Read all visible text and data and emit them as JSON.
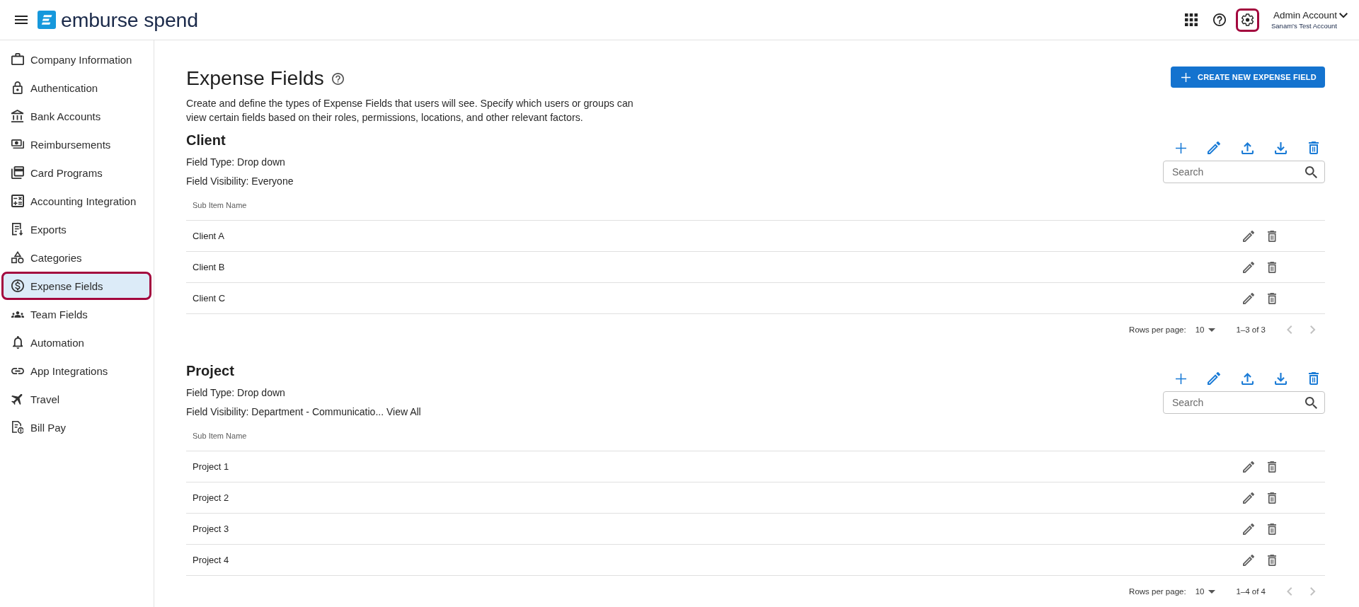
{
  "header": {
    "brand": "emburse spend",
    "actions": [
      {
        "kind": "apps",
        "highlighted": false
      },
      {
        "kind": "help",
        "highlighted": false
      },
      {
        "kind": "settings",
        "highlighted": true
      }
    ],
    "account": {
      "name": "Admin Account",
      "company": "Sanam's Test Account"
    }
  },
  "sidebar": {
    "items": [
      {
        "kind": "company",
        "label": "Company Information",
        "selected": false,
        "highlighted": false
      },
      {
        "kind": "authentication",
        "label": "Authentication",
        "selected": false,
        "highlighted": false
      },
      {
        "kind": "bank",
        "label": "Bank Accounts",
        "selected": false,
        "highlighted": false
      },
      {
        "kind": "reimbursements",
        "label": "Reimbursements",
        "selected": false,
        "highlighted": false
      },
      {
        "kind": "cards",
        "label": "Card Programs",
        "selected": false,
        "highlighted": false
      },
      {
        "kind": "accounting",
        "label": "Accounting Integration",
        "selected": false,
        "highlighted": false
      },
      {
        "kind": "exports",
        "label": "Exports",
        "selected": false,
        "highlighted": false
      },
      {
        "kind": "categories",
        "label": "Categories",
        "selected": false,
        "highlighted": false
      },
      {
        "kind": "expenses",
        "label": "Expense Fields",
        "selected": true,
        "highlighted": true
      },
      {
        "kind": "team",
        "label": "Team Fields",
        "selected": false,
        "highlighted": false
      },
      {
        "kind": "automation",
        "label": "Automation",
        "selected": false,
        "highlighted": false
      },
      {
        "kind": "integrations",
        "label": "App Integrations",
        "selected": false,
        "highlighted": false
      },
      {
        "kind": "travel",
        "label": "Travel",
        "selected": false,
        "highlighted": false
      },
      {
        "kind": "billpay",
        "label": "Bill Pay",
        "selected": false,
        "highlighted": false
      }
    ]
  },
  "page": {
    "title": "Expense Fields",
    "description": "Create and define the types of Expense Fields that users will see. Specify which users or groups can view certain fields based on their roles, permissions, locations, and other relevant factors.",
    "create_button": "CREATE NEW EXPENSE FIELD"
  },
  "expense_fields": [
    {
      "name": "Client",
      "field_type": "Field Type: Drop down",
      "visibility": "Field Visibility: Everyone",
      "search": {
        "placeholder": "Search"
      },
      "columns": [
        "Sub Item Name"
      ],
      "rows": [
        "Client A",
        "Client B",
        "Client C"
      ],
      "pagination": {
        "label": "Rows per page:",
        "rows_per_page": "10",
        "range": "1–3 of 3",
        "previous": {
          "disabled": true
        },
        "next": {
          "disabled": true
        }
      }
    },
    {
      "name": "Project",
      "field_type": "Field Type: Drop down",
      "visibility": "Field Visibility: Department - Communicatio...",
      "view_all": "View All",
      "search": {
        "placeholder": "Search"
      },
      "columns": [
        "Sub Item Name"
      ],
      "rows": [
        "Project 1",
        "Project 2",
        "Project 3",
        "Project 4"
      ],
      "pagination": {
        "label": "Rows per page:",
        "rows_per_page": "10",
        "range": "1–4 of 4",
        "previous": {
          "disabled": true
        },
        "next": {
          "disabled": true
        }
      }
    }
  ]
}
